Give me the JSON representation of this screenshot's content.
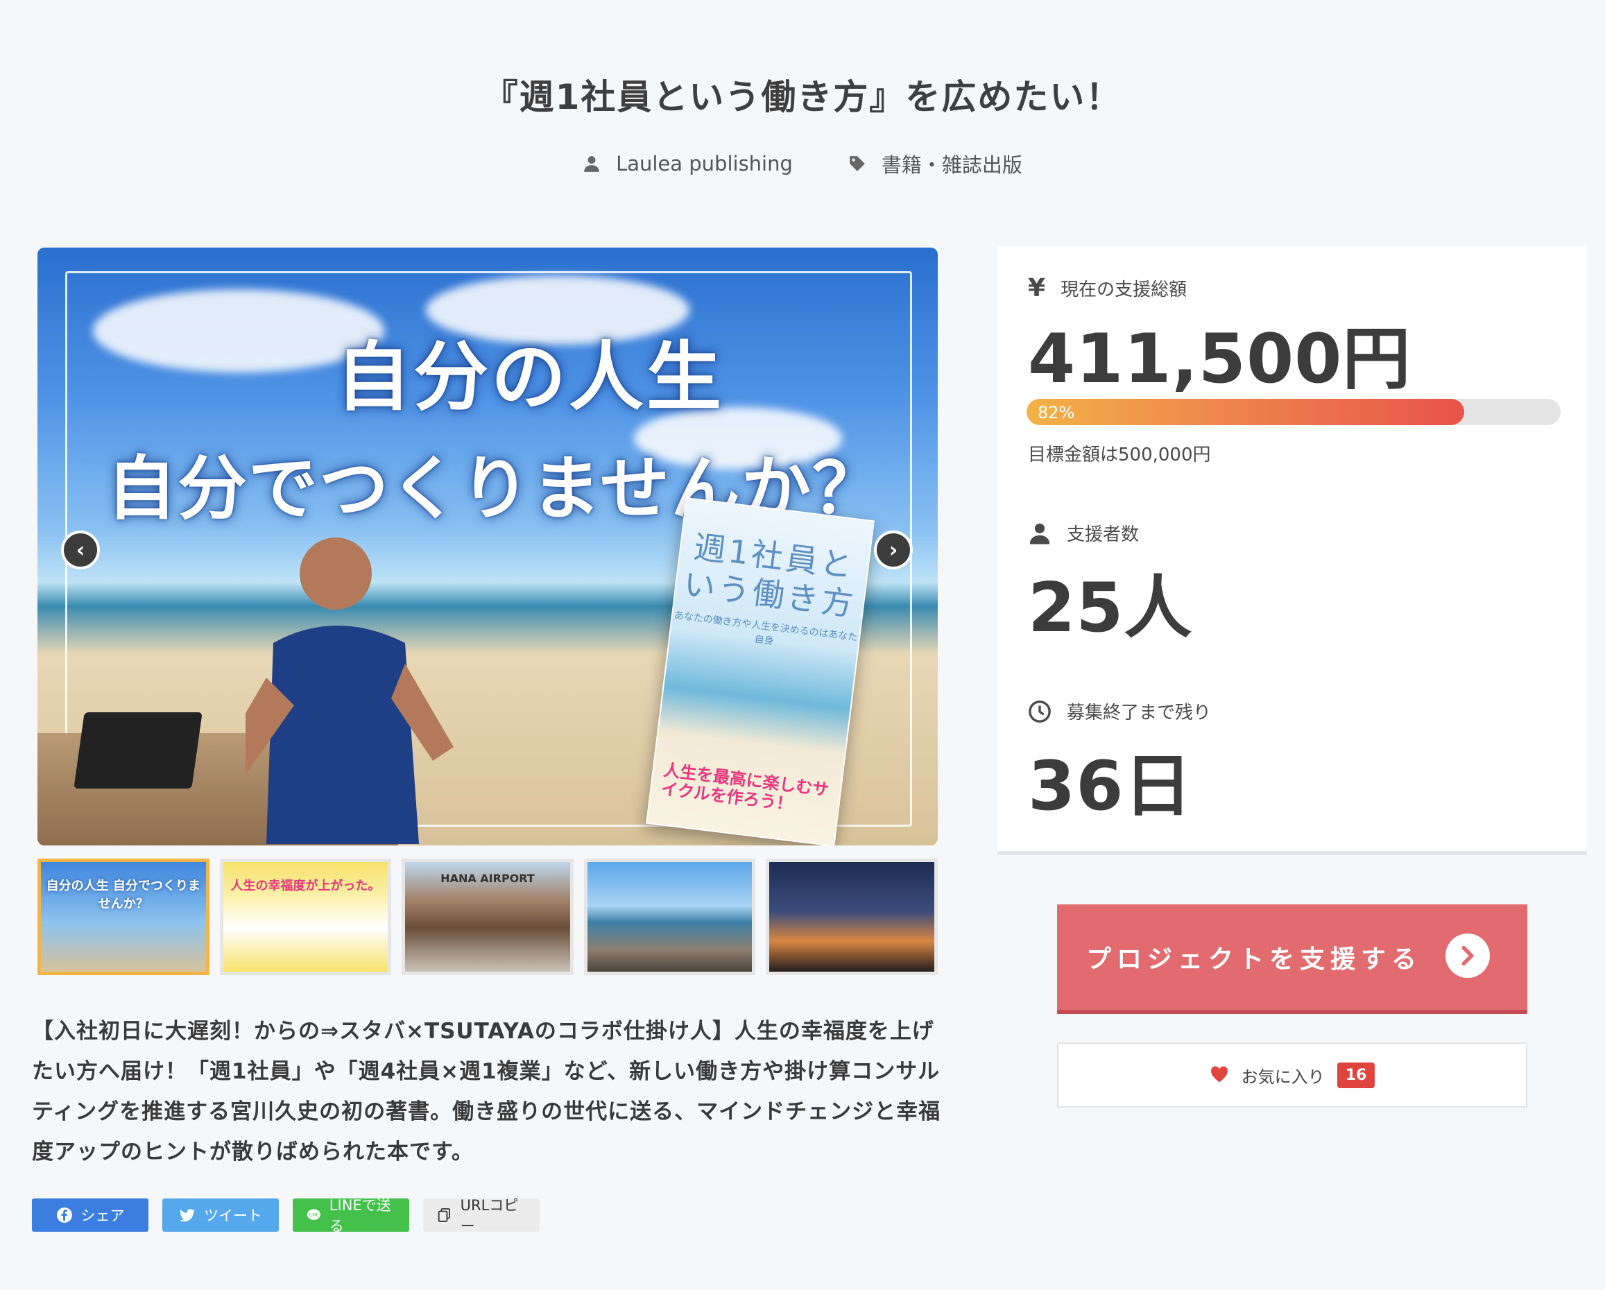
{
  "project": {
    "title": "『週1社員という働き方』を広めたい！",
    "author": "Laulea publishing",
    "category": "書籍・雑誌出版"
  },
  "hero": {
    "headline_line1": "自分の人生",
    "headline_line2": "自分でつくりませんか？",
    "book_title": "週1社員という働き方",
    "book_subtitle": "あなたの働き方や人生を決めるのはあなた自身",
    "book_band": "人生を最高に楽しむサイクルを作ろう！",
    "prev_icon": "chevron-left-icon",
    "next_icon": "chevron-right-icon"
  },
  "thumbnails": [
    {
      "caption": "自分の人生 自分でつくりませんか？",
      "active": true
    },
    {
      "caption": "人生の幸福度が上がった。",
      "active": false
    },
    {
      "caption": "HANA AIRPORT",
      "active": false
    },
    {
      "caption": "",
      "active": false
    },
    {
      "caption": "",
      "active": false
    }
  ],
  "description": "【入社初日に大遅刻！からの⇒スタバ×TSUTAYAのコラボ仕掛け人】人生の幸福度を上げたい方へ届け！「週1社員」や「週4社員×週1複業」など、新しい働き方や掛け算コンサルティングを推進する宮川久史の初の著書。働き盛りの世代に送る、マインドチェンジと幸福度アップのヒントが散りばめられた本です。",
  "share": {
    "facebook": "シェア",
    "twitter": "ツイート",
    "line": "LINEで送る",
    "copy": "URLコピー"
  },
  "stats": {
    "total_label": "現在の支援総額",
    "total_value": "411,500円",
    "progress_label": "82%",
    "progress_fraction": 0.82,
    "goal": "目標金額は500,000円",
    "supporters_label": "支援者数",
    "supporters_value": "25人",
    "remaining_label": "募集終了まで残り",
    "remaining_value": "36日"
  },
  "actions": {
    "support": "プロジェクトを支援する",
    "favorite": "お気に入り",
    "favorite_count": "16"
  },
  "colors": {
    "accent": "#e26b6f",
    "progress_start": "#f3b246",
    "progress_end": "#e8534a",
    "facebook": "#3b7ee0",
    "twitter": "#55a8ec",
    "line": "#43c14a"
  }
}
